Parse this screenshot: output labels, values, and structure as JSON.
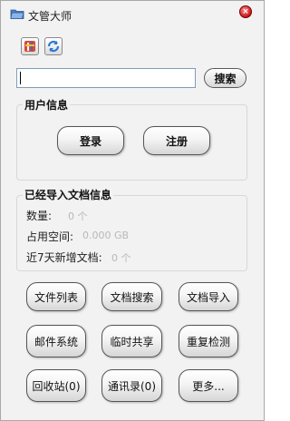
{
  "window": {
    "title": "文管大师",
    "close_icon": "close-icon"
  },
  "toolbar": {
    "icons": [
      "tools-icon",
      "refresh-icon"
    ]
  },
  "search": {
    "value": "",
    "placeholder": "",
    "button_label": "搜索"
  },
  "user_info": {
    "title": "用户信息",
    "login_label": "登录",
    "register_label": "注册"
  },
  "doc_info": {
    "title": "已经导入文档信息",
    "count_label": "数量:",
    "count_value": "0 个",
    "space_label": "占用空间:",
    "space_value": "0.000 GB",
    "recent_label": "近7天新增文档:",
    "recent_value": "0 个"
  },
  "actions": {
    "row1": [
      "文件列表",
      "文档搜索",
      "文档导入"
    ],
    "row2": [
      "邮件系统",
      "临时共享",
      "重复检测"
    ],
    "row3": [
      "回收站(0)",
      "通讯录(0)",
      "更多..."
    ]
  },
  "colors": {
    "close": "#c81818",
    "input_border": "#7f9db9",
    "muted_value": "#b8b8b8"
  }
}
